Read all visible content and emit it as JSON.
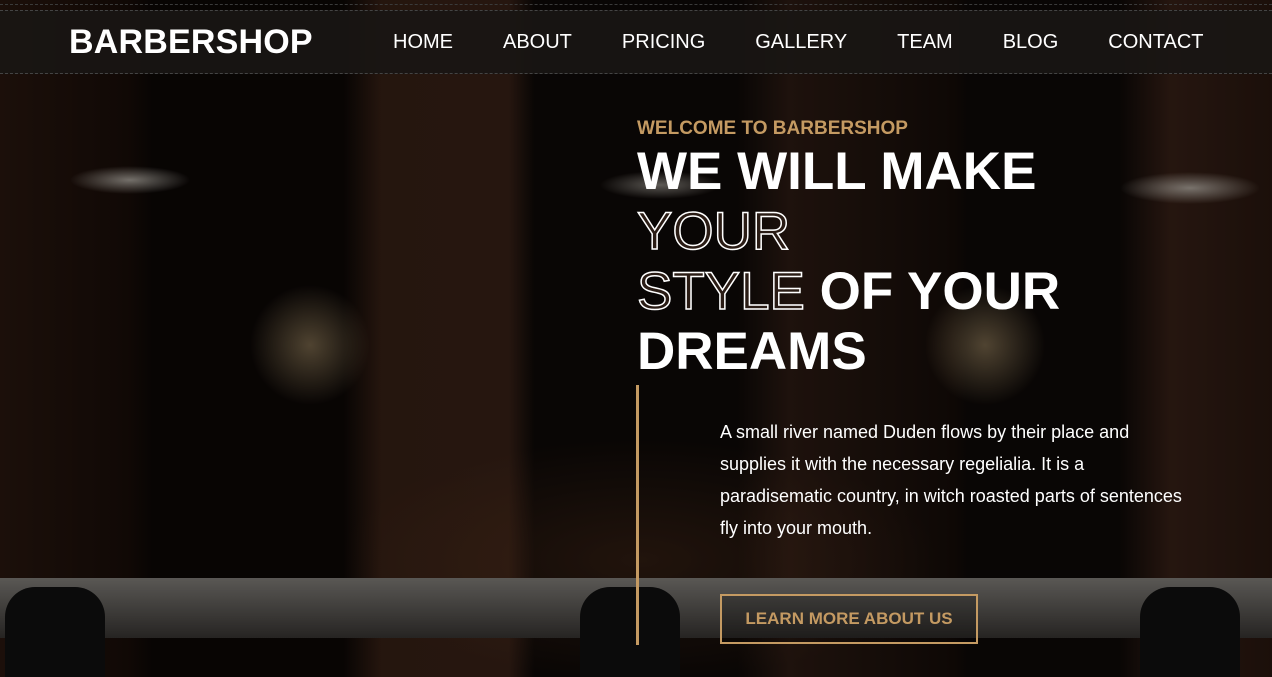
{
  "nav": {
    "brand": "BARBERSHOP",
    "items": [
      "HOME",
      "ABOUT",
      "PRICING",
      "GALLERY",
      "TEAM",
      "BLOG",
      "CONTACT"
    ]
  },
  "hero": {
    "subtitle": "WELCOME TO BARBERSHOP",
    "title_line1": "WE WILL MAKE",
    "title_outline1": "YOUR",
    "title_outline2": "STYLE",
    "title_rest": " OF YOUR",
    "title_line4": "DREAMS",
    "paragraph": "A small river named Duden flows by their place and supplies it with the necessary regelialia. It is a paradisematic country, in witch roasted parts of sentences fly into your mouth.",
    "button": "LEARN MORE ABOUT US"
  },
  "colors": {
    "accent": "#c49a62"
  }
}
